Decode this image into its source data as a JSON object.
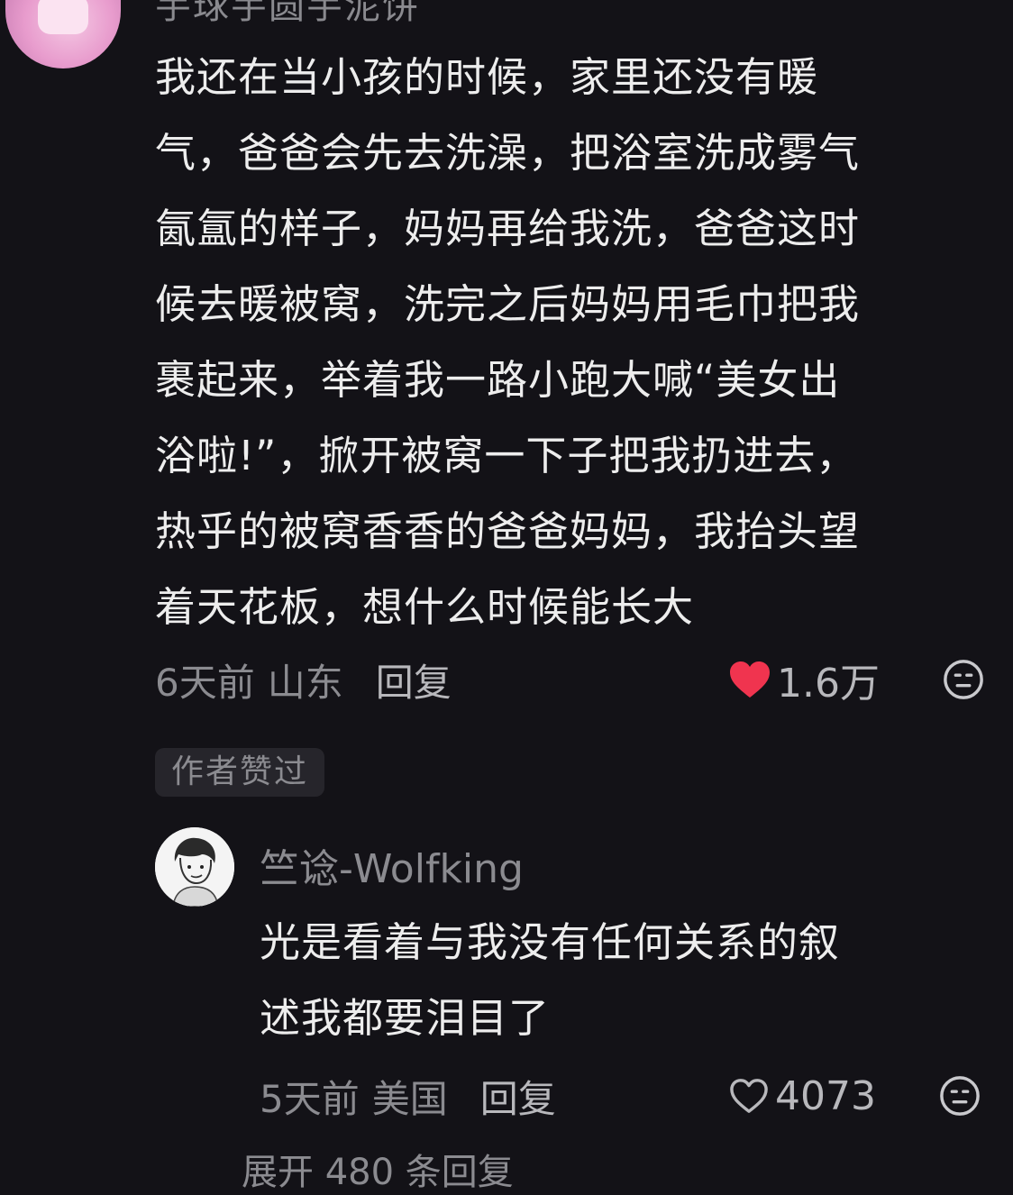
{
  "top_comment": {
    "username": "芋球芋圆芋泥饼",
    "lines": [
      "我还在当小孩的时候，家里还没有暖",
      "气，爸爸会先去洗澡，把浴室洗成雾气",
      "氤氲的样子，妈妈再给我洗，爸爸这时",
      "候去暖被窝，洗完之后妈妈用毛巾把我",
      "裹起来，举着我一路小跑大喊“美女出",
      "浴啦!”，掀开被窝一下子把我扔进去，",
      "热乎的被窝香香的爸爸妈妈，我抬头望",
      "着天花板，想什么时候能长大"
    ],
    "time": "6天前",
    "location": "山东",
    "reply_label": "回复",
    "likes": "1.6万",
    "liked": true,
    "heart_color": "#f0344f",
    "author_badge": "作者赞过"
  },
  "reply_comment": {
    "username": "竺谂-Wolfking",
    "lines": [
      "光是看着与我没有任何关系的叙",
      "述我都要泪目了"
    ],
    "time": "5天前",
    "location": "美国",
    "reply_label": "回复",
    "likes": "4073",
    "liked": false
  },
  "expand_label": "展开 480 条回复",
  "icons": {
    "like_filled": "heart-filled-icon",
    "like_outline": "heart-outline-icon",
    "dislike": "dislike-face-icon"
  }
}
